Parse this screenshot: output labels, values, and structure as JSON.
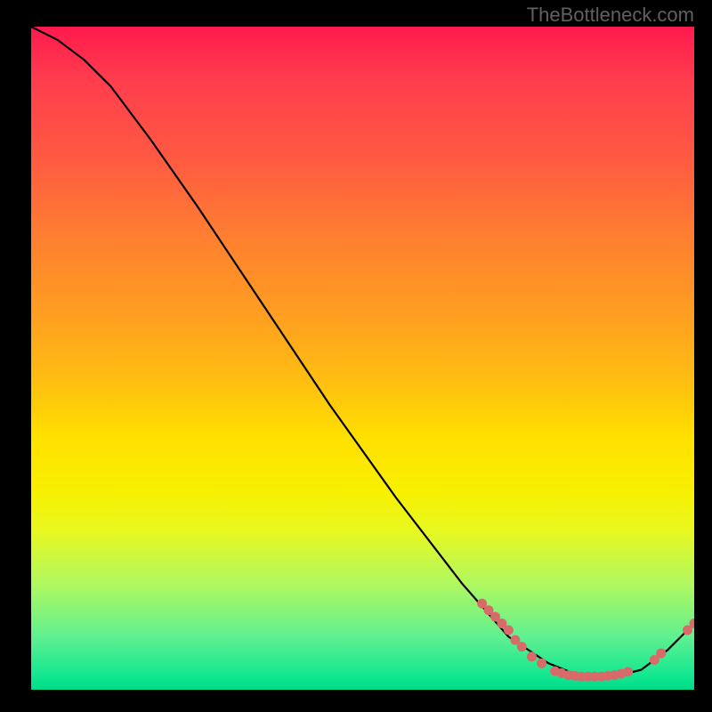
{
  "watermark": "TheBottleneck.com",
  "chart_data": {
    "type": "line",
    "title": "",
    "xlabel": "",
    "ylabel": "",
    "xlim": [
      0,
      100
    ],
    "ylim": [
      0,
      100
    ],
    "curve": [
      {
        "x": 0,
        "y": 100
      },
      {
        "x": 4,
        "y": 98
      },
      {
        "x": 8,
        "y": 95
      },
      {
        "x": 12,
        "y": 91
      },
      {
        "x": 18,
        "y": 83
      },
      {
        "x": 25,
        "y": 73
      },
      {
        "x": 35,
        "y": 58
      },
      {
        "x": 45,
        "y": 43
      },
      {
        "x": 55,
        "y": 29
      },
      {
        "x": 65,
        "y": 16
      },
      {
        "x": 72,
        "y": 8
      },
      {
        "x": 78,
        "y": 4
      },
      {
        "x": 83,
        "y": 2
      },
      {
        "x": 88,
        "y": 2
      },
      {
        "x": 92,
        "y": 3
      },
      {
        "x": 96,
        "y": 6
      },
      {
        "x": 100,
        "y": 10
      }
    ],
    "markers": [
      {
        "x": 68,
        "y": 13
      },
      {
        "x": 69,
        "y": 12
      },
      {
        "x": 70,
        "y": 11
      },
      {
        "x": 71,
        "y": 10
      },
      {
        "x": 72,
        "y": 9
      },
      {
        "x": 73,
        "y": 7.5
      },
      {
        "x": 74,
        "y": 6.5
      },
      {
        "x": 75.5,
        "y": 5
      },
      {
        "x": 77,
        "y": 4
      },
      {
        "x": 79,
        "y": 2.8
      },
      {
        "x": 80,
        "y": 2.5
      },
      {
        "x": 81,
        "y": 2.2
      },
      {
        "x": 82,
        "y": 2.1
      },
      {
        "x": 83,
        "y": 2
      },
      {
        "x": 84,
        "y": 2
      },
      {
        "x": 85,
        "y": 2
      },
      {
        "x": 86,
        "y": 2
      },
      {
        "x": 87,
        "y": 2.1
      },
      {
        "x": 88,
        "y": 2.2
      },
      {
        "x": 89,
        "y": 2.4
      },
      {
        "x": 90,
        "y": 2.7
      },
      {
        "x": 94,
        "y": 4.5
      },
      {
        "x": 95,
        "y": 5.5
      },
      {
        "x": 99,
        "y": 9
      },
      {
        "x": 100,
        "y": 10
      }
    ],
    "marker_color": "#d96a6a",
    "line_color": "#000000"
  }
}
